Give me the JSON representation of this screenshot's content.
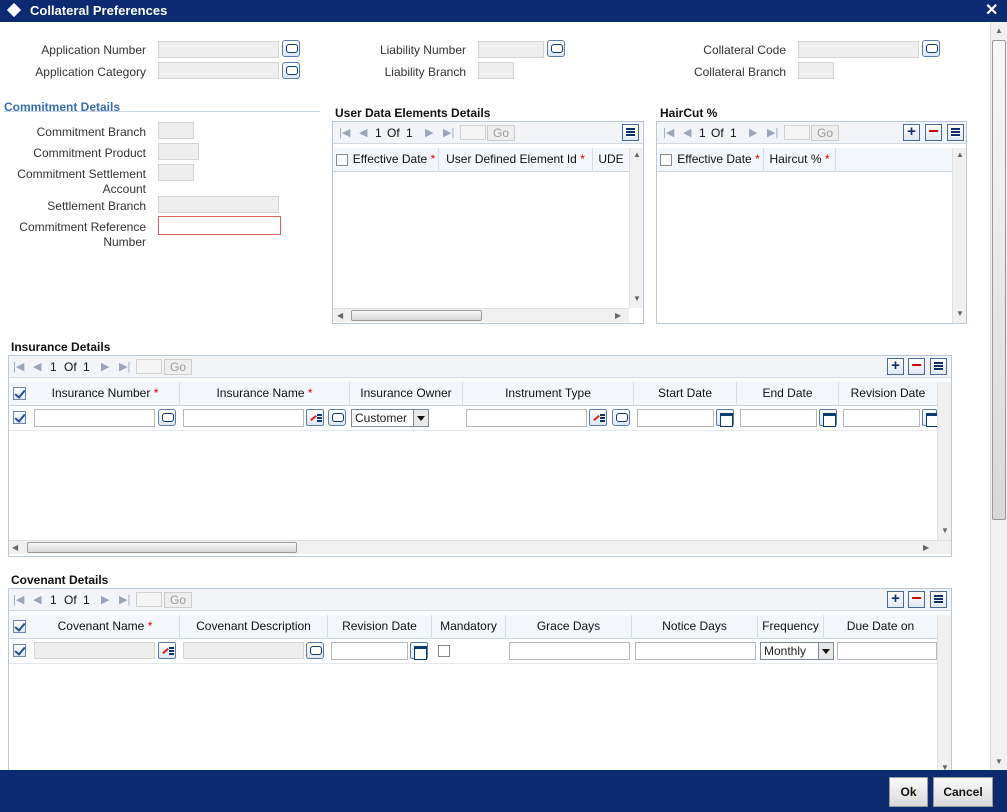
{
  "window": {
    "title": "Collateral Preferences",
    "close": "✕"
  },
  "header_fields": {
    "application_number": "Application Number",
    "application_category": "Application Category",
    "liability_number": "Liability Number",
    "liability_branch": "Liability Branch",
    "collateral_code": "Collateral Code",
    "collateral_branch": "Collateral Branch"
  },
  "commitment": {
    "section_title": "Commitment Details",
    "branch": "Commitment Branch",
    "product": "Commitment Product",
    "settlement_account_1": "Commitment Settlement",
    "settlement_account_2": "Account",
    "settlement_branch": "Settlement Branch",
    "reference_1": "Commitment Reference",
    "reference_2": "Number"
  },
  "ude": {
    "section_title": "User Data Elements Details",
    "page": "1",
    "of": "Of",
    "total": "1",
    "go": "Go",
    "columns": [
      "Effective Date",
      "User Defined Element Id",
      "UDE"
    ]
  },
  "haircut": {
    "section_title": "HairCut %",
    "page": "1",
    "of": "Of",
    "total": "1",
    "go": "Go",
    "columns": [
      "Effective Date",
      "Haircut %"
    ]
  },
  "insurance": {
    "section_title": "Insurance Details",
    "page": "1",
    "of": "Of",
    "total": "1",
    "go": "Go",
    "columns": [
      "Insurance Number",
      "Insurance Name",
      "Insurance Owner",
      "Instrument Type",
      "Start Date",
      "End Date",
      "Revision Date"
    ],
    "row_owner": "Customer"
  },
  "covenant": {
    "section_title": "Covenant Details",
    "page": "1",
    "of": "Of",
    "total": "1",
    "go": "Go",
    "columns": [
      "Covenant Name",
      "Covenant Description",
      "Revision Date",
      "Mandatory",
      "Grace Days",
      "Notice Days",
      "Frequency",
      "Due Date on"
    ],
    "row_frequency": "Monthly"
  },
  "footer": {
    "ok": "Ok",
    "cancel": "Cancel"
  },
  "colors": {
    "titlebar": "#0b2a6f",
    "section_blue": "#3a6fae",
    "required": "#dd0000"
  }
}
